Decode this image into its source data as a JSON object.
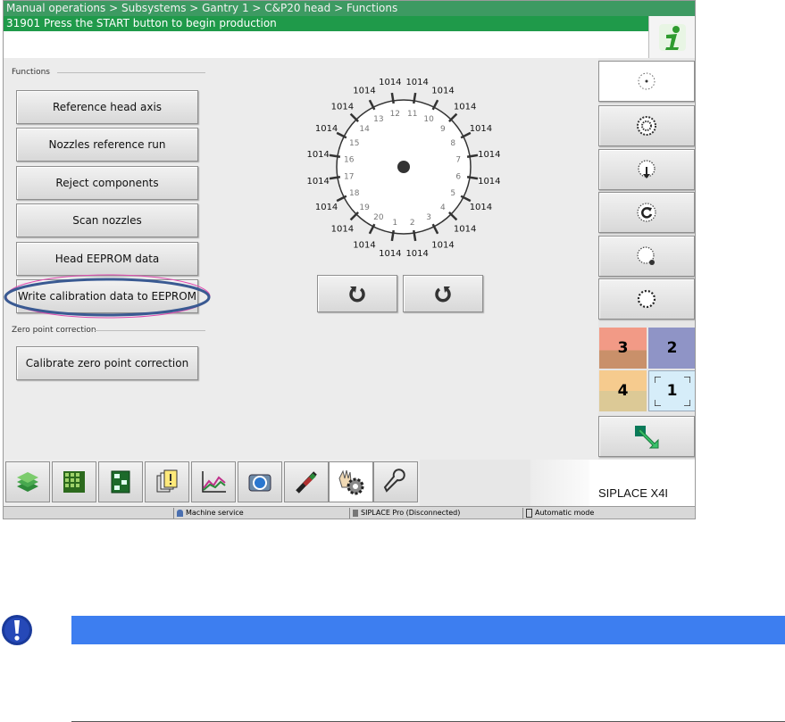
{
  "header": {
    "breadcrumb": "Manual operations > Subsystems > Gantry 1 > C&P20 head > Functions",
    "message": "31901 Press the START button to begin production",
    "info_icon": "info-icon"
  },
  "functions": {
    "section_label": "Functions",
    "buttons": [
      "Reference head axis",
      "Nozzles reference run",
      "Reject components",
      "Scan nozzles",
      "Head EEPROM data",
      "Write calibration data to EEPROM"
    ],
    "highlighted_button": "Write calibration data to EEPROM"
  },
  "zero_point": {
    "section_label": "Zero point correction",
    "button": "Calibrate zero point correction"
  },
  "dial": {
    "segment_numbers": [
      "1",
      "2",
      "3",
      "4",
      "5",
      "6",
      "7",
      "8",
      "9",
      "10",
      "11",
      "12",
      "13",
      "14",
      "15",
      "16",
      "17",
      "18",
      "19",
      "20"
    ],
    "segment_values": [
      "1014",
      "1014",
      "1014",
      "1014",
      "1014",
      "1014",
      "1014",
      "1014",
      "1014",
      "1014",
      "1014",
      "1014",
      "1014",
      "1014",
      "1014",
      "1014",
      "1014",
      "1014",
      "1014",
      "1014"
    ],
    "rotate_left_icon": "rotate-counterclockwise-icon",
    "rotate_right_icon": "rotate-clockwise-icon"
  },
  "right_panel": {
    "icons": [
      "single-nozzle-icon",
      "star-head-icon",
      "nozzle-down-icon",
      "nozzle-rotate-icon",
      "nozzle-pickup-icon",
      "segment-ring-icon"
    ],
    "gantry_tiles": [
      {
        "label": "3",
        "color": "#e08474"
      },
      {
        "label": "2",
        "color": "#8f94c6"
      },
      {
        "label": "4",
        "color": "#f2c27a"
      },
      {
        "label": "1",
        "color": "#cfe8f7"
      }
    ],
    "back_icon": "green-arrow-back-icon"
  },
  "taskbar": {
    "icons": [
      "components-icon",
      "grid-icon",
      "board-icon",
      "messages-icon",
      "chart-icon",
      "camera-icon",
      "feeder-icon",
      "manual-operations-icon",
      "service-wrench-icon"
    ],
    "brand": "SIPLACE X4I"
  },
  "statusbar": {
    "user": "Machine service",
    "connection": "SIPLACE Pro (Disconnected)",
    "mode": "Automatic mode"
  },
  "notice": {
    "icon": "exclamation-icon"
  }
}
